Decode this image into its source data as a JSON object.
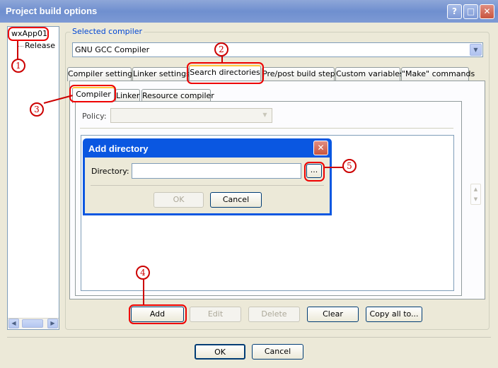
{
  "window": {
    "title": "Project build options"
  },
  "tree": {
    "root": "wxApp01",
    "child": "Release"
  },
  "compiler_group": {
    "label": "Selected compiler",
    "value": "GNU GCC Compiler"
  },
  "tabs": [
    {
      "label": "Compiler settings"
    },
    {
      "label": "Linker settings"
    },
    {
      "label": "Search directories"
    },
    {
      "label": "Pre/post build steps"
    },
    {
      "label": "Custom variables"
    },
    {
      "label": "\"Make\" commands"
    }
  ],
  "subtabs": [
    {
      "label": "Compiler"
    },
    {
      "label": "Linker"
    },
    {
      "label": "Resource compiler"
    }
  ],
  "policy": {
    "label": "Policy:",
    "value": ""
  },
  "dialog": {
    "title": "Add directory",
    "directory_label": "Directory:",
    "directory_value": "",
    "browse_label": "...",
    "ok_label": "OK",
    "cancel_label": "Cancel"
  },
  "list_buttons": {
    "add": "Add",
    "edit": "Edit",
    "delete": "Delete",
    "clear": "Clear",
    "copy_all": "Copy all to..."
  },
  "footer": {
    "ok": "OK",
    "cancel": "Cancel"
  },
  "callouts": [
    "1",
    "2",
    "3",
    "4",
    "5"
  ],
  "colors": {
    "highlight": "#e00000",
    "xp_blue": "#0a57e1",
    "active_tab": "#ffc83c"
  }
}
